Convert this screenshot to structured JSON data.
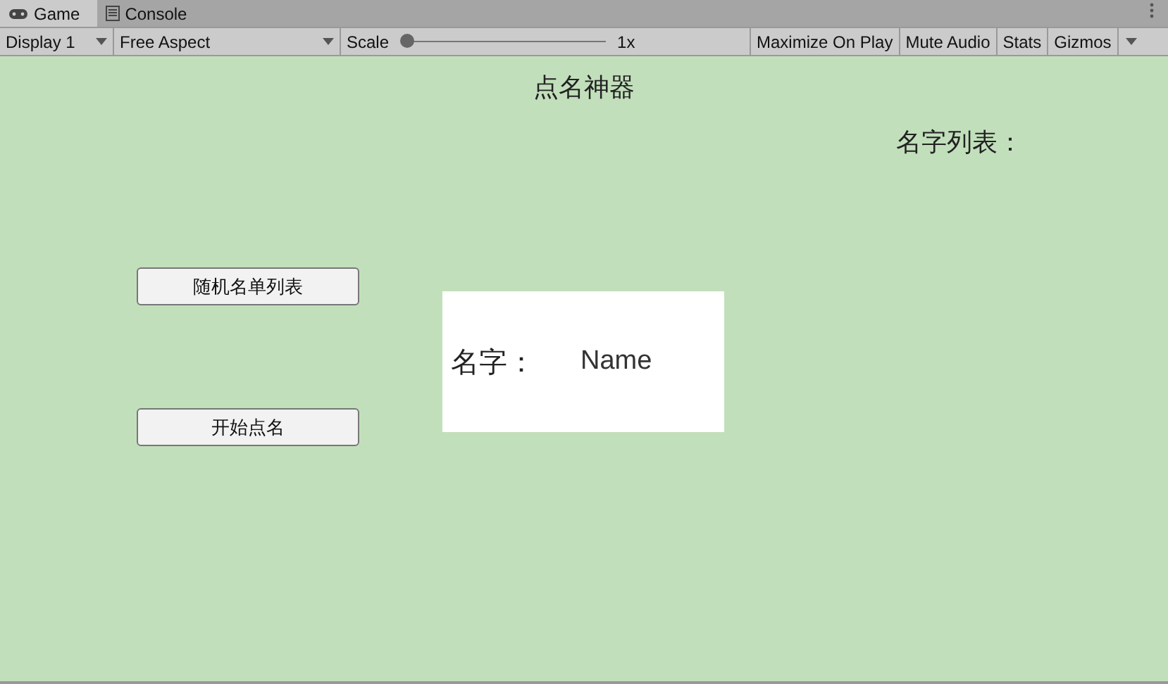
{
  "tabs": [
    {
      "label": "Game",
      "selected": true
    },
    {
      "label": "Console",
      "selected": false
    }
  ],
  "toolbar": {
    "display": "Display 1",
    "aspect": "Free Aspect",
    "scale": {
      "label": "Scale",
      "level": 0,
      "reading": "1x"
    },
    "buttons": [
      "Maximize On Play",
      "Mute Audio",
      "Stats"
    ],
    "gizmos": "Gizmos"
  },
  "game": {
    "title": "点名神器",
    "list_label": "名字列表：",
    "buttons": [
      "随机名单列表",
      "开始点名"
    ],
    "name_panel": {
      "label": "名字：",
      "value": "Name"
    }
  }
}
